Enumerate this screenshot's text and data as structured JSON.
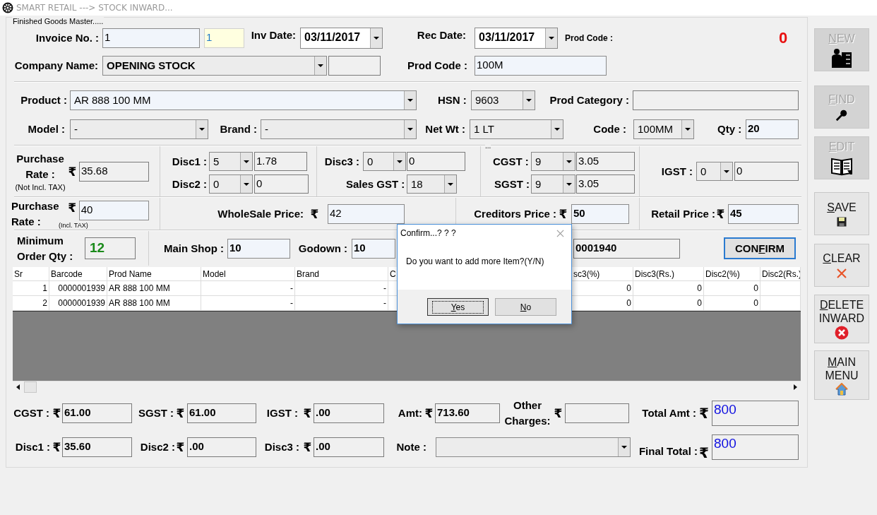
{
  "window": {
    "title": "SMART RETAIL ---> STOCK INWARD..."
  },
  "group_caption": "Finished Goods Master.....",
  "invoice": {
    "label": "Invoice No. :",
    "value": "1",
    "serial": "1"
  },
  "inv_date": {
    "label": "Inv Date:",
    "value": "03/11/2017"
  },
  "rec_date": {
    "label": "Rec Date:",
    "value": "03/11/2017"
  },
  "prod_code_caption": "Prod Code :",
  "counter": "0",
  "company": {
    "label": "Company Name:",
    "value": "OPENING STOCK"
  },
  "prod_code": {
    "label": "Prod Code :",
    "value": "100M"
  },
  "product": {
    "label": "Product :",
    "value": "AR 888 100 MM"
  },
  "hsn": {
    "label": "HSN :",
    "value": "9603"
  },
  "prod_category": {
    "label": "Prod Category :"
  },
  "model": {
    "label": "Model :",
    "value": "-"
  },
  "brand": {
    "label": "Brand :",
    "value": "-"
  },
  "net_wt": {
    "label": "Net Wt :",
    "value": "1 LT"
  },
  "code": {
    "label": "Code :",
    "value": "100MM"
  },
  "qty": {
    "label": "Qty :",
    "value": "20"
  },
  "purchase_rate": {
    "label": "Purchase Rate :",
    "note": "(Not Incl. TAX)",
    "currency": "₹",
    "value": "35.68"
  },
  "disc1": {
    "label": "Disc1 :",
    "percent": "5",
    "amount": "1.78"
  },
  "disc2": {
    "label": "Disc2 :",
    "percent": "0",
    "amount": "0"
  },
  "disc3": {
    "label": "Disc3 :",
    "percent": "0",
    "amount": "0"
  },
  "sales_gst": {
    "label": "Sales GST :",
    "value": "18"
  },
  "tax_caption": "...",
  "cgst": {
    "label": "CGST :",
    "percent": "9",
    "amount": "3.05"
  },
  "sgst": {
    "label": "SGST :",
    "percent": "9",
    "amount": "3.05"
  },
  "igst": {
    "label": "IGST :",
    "percent": "0",
    "amount": "0"
  },
  "purchase_rate_incl": {
    "label": "Purchase Rate :",
    "note": "(Incl. TAX)",
    "currency": "₹",
    "value": "40"
  },
  "wholesale_price": {
    "label": "WholeSale Price:",
    "currency": "₹",
    "value": "42"
  },
  "creditors_price": {
    "label": "Creditors Price :",
    "currency": "₹",
    "value": "50"
  },
  "retail_price": {
    "label": "Retail Price :",
    "currency": "₹",
    "value": "45"
  },
  "min_order_qty": {
    "label": "Minimum Order Qty :",
    "value": "12"
  },
  "main_shop": {
    "label": "Main Shop :",
    "value": "10"
  },
  "godown": {
    "label": "Godown :",
    "value": "10"
  },
  "barcode": {
    "value": "0001940"
  },
  "confirm_button": {
    "pre": "CON",
    "key": "F",
    "post": "IRM",
    "focused": true
  },
  "table": {
    "columns": [
      "Sr",
      "Barcode",
      "Prod Name",
      "Model",
      "Brand",
      "C",
      null,
      "sc3(%)",
      "Disc3(Rs.)",
      "Disc2(%)",
      "Disc2(Rs.)"
    ],
    "rows": [
      [
        "1",
        "0000001939",
        "AR 888 100 MM",
        "-",
        "-",
        null,
        null,
        "0",
        "0",
        "0",
        null
      ],
      [
        "2",
        "0000001939",
        "AR 888 100 MM",
        "-",
        "-",
        null,
        null,
        "0",
        "0",
        "0",
        null
      ]
    ]
  },
  "summary": {
    "cgst": {
      "label": "CGST :",
      "currency": "₹",
      "value": "61.00"
    },
    "sgst": {
      "label": "SGST :",
      "currency": "₹",
      "value": "61.00"
    },
    "igst": {
      "label": "IGST :",
      "currency": "₹",
      "value": ".00"
    },
    "amount": {
      "label": "Amt:",
      "currency": "₹",
      "value": "713.60"
    },
    "other_charges": {
      "label": "Other Charges:",
      "currency": "₹"
    },
    "total_amt": {
      "label": "Total Amt :",
      "currency": "₹",
      "value": "800"
    },
    "disc1": {
      "label": "Disc1 :",
      "currency": "₹",
      "value": "35.60"
    },
    "disc2": {
      "label": "Disc2 :",
      "currency": "₹",
      "value": ".00"
    },
    "disc3": {
      "label": "Disc3 :",
      "currency": "₹",
      "value": ".00"
    },
    "note": {
      "label": "Note :"
    },
    "final_total": {
      "label": "Final Total :",
      "currency": "₹",
      "value": "800"
    }
  },
  "side_buttons": [
    {
      "kind": "new",
      "key": "N",
      "post": "EW",
      "disabled": true
    },
    {
      "kind": "find",
      "key": "F",
      "post": "IND",
      "disabled": true
    },
    {
      "kind": "edit",
      "key": "E",
      "post": "DIT",
      "disabled": true
    },
    {
      "kind": "save",
      "key": "S",
      "post": "AVE",
      "disabled": false
    },
    {
      "kind": "clear",
      "key": "C",
      "post": "LEAR",
      "disabled": false
    },
    {
      "kind": "delete",
      "key": "D",
      "post": "ELETE INWARD",
      "disabled": false
    },
    {
      "kind": "main_menu",
      "key": "M",
      "post": "AIN MENU",
      "disabled": false
    }
  ],
  "dialog": {
    "title": "Confirm...? ? ?",
    "message": "Do you want to add more Item?(Y/N)",
    "buttons": [
      {
        "key": "Y",
        "post": "es",
        "focused": true
      },
      {
        "key": "N",
        "post": "o",
        "focused": false
      }
    ]
  }
}
